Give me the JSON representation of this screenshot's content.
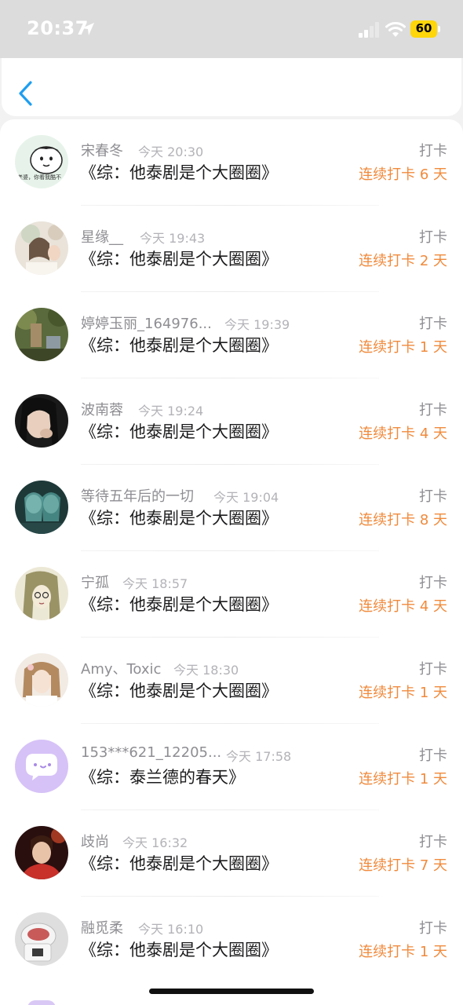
{
  "status_bar": {
    "time": "20:37",
    "battery": "60",
    "icons": [
      "location-arrow-icon",
      "cellular-signal-icon",
      "wifi-icon",
      "battery-icon"
    ],
    "battery_color": "#ffd60a"
  },
  "nav": {
    "back_icon": "chevron-left-icon",
    "accent_color": "#1e9ef0"
  },
  "colors": {
    "streak": "#f08a3c",
    "meta": "#8e8e93",
    "title": "#1c1c1e"
  },
  "rows": [
    {
      "name": "宋春冬",
      "time": "今天 20:30",
      "title": "《综：他泰剧是个大圈圈》",
      "action": "打卡",
      "streak": "连续打卡 6 天"
    },
    {
      "name": "星缘__",
      "time": "今天 19:43",
      "title": "《综：他泰剧是个大圈圈》",
      "action": "打卡",
      "streak": "连续打卡 2 天"
    },
    {
      "name": "婷婷玉丽_164976...",
      "time": "今天 19:39",
      "title": "《综：他泰剧是个大圈圈》",
      "action": "打卡",
      "streak": "连续打卡 1 天"
    },
    {
      "name": "波南蓉",
      "time": "今天 19:24",
      "title": "《综：他泰剧是个大圈圈》",
      "action": "打卡",
      "streak": "连续打卡 4 天"
    },
    {
      "name": "等待五年后的一切",
      "time": "今天 19:04",
      "title": "《综：他泰剧是个大圈圈》",
      "action": "打卡",
      "streak": "连续打卡 8 天"
    },
    {
      "name": "宁孤",
      "time": "今天 18:57",
      "title": "《综：他泰剧是个大圈圈》",
      "action": "打卡",
      "streak": "连续打卡 4 天"
    },
    {
      "name": "Amy、Toxic",
      "time": "今天 18:30",
      "title": "《综：他泰剧是个大圈圈》",
      "action": "打卡",
      "streak": "连续打卡 1 天"
    },
    {
      "name": "153***621_12205...",
      "time": "今天 17:58",
      "title": "《综：泰兰德的春天》",
      "action": "打卡",
      "streak": "连续打卡 1 天"
    },
    {
      "name": "歧尚",
      "time": "今天 16:32",
      "title": "《综：他泰剧是个大圈圈》",
      "action": "打卡",
      "streak": "连续打卡 7 天"
    },
    {
      "name": "融觅柔",
      "time": "今天 16:10",
      "title": "《综：他泰剧是个大圈圈》",
      "action": "打卡",
      "streak": "连续打卡 1 天"
    }
  ],
  "avatar_text": {
    "row0": "老婆，你看我酷不"
  }
}
